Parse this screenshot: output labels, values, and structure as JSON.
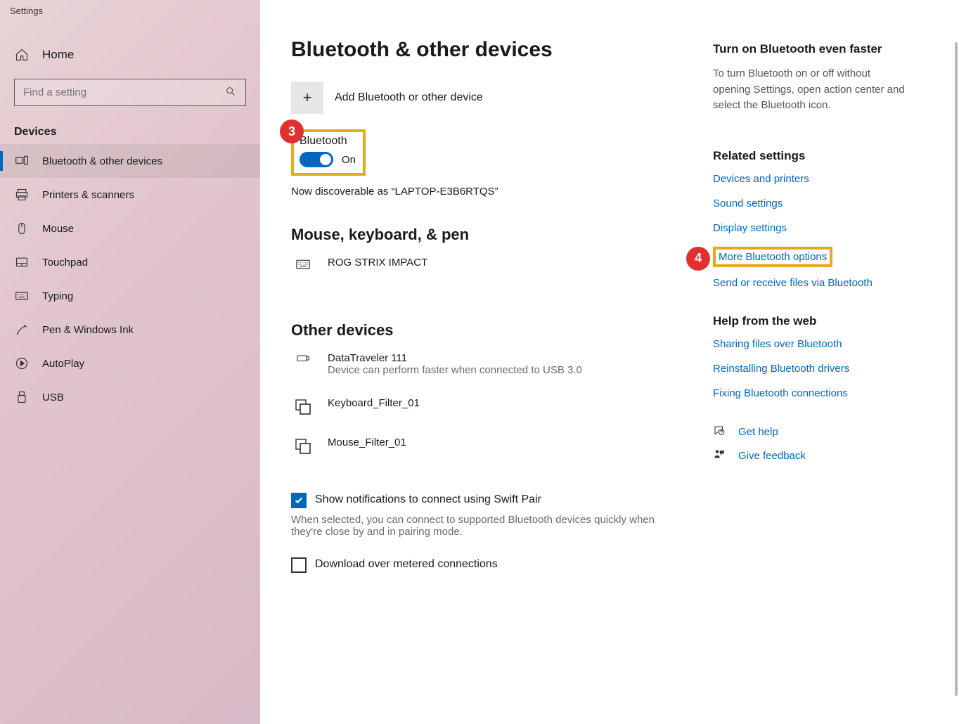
{
  "window": {
    "title": "Settings"
  },
  "sidebar": {
    "home_label": "Home",
    "search_placeholder": "Find a setting",
    "category": "Devices",
    "items": [
      {
        "label": "Bluetooth & other devices"
      },
      {
        "label": "Printers & scanners"
      },
      {
        "label": "Mouse"
      },
      {
        "label": "Touchpad"
      },
      {
        "label": "Typing"
      },
      {
        "label": "Pen & Windows Ink"
      },
      {
        "label": "AutoPlay"
      },
      {
        "label": "USB"
      }
    ]
  },
  "main": {
    "title": "Bluetooth & other devices",
    "add_label": "Add Bluetooth or other device",
    "bt_label": "Bluetooth",
    "bt_state": "On",
    "discoverable": "Now discoverable as “LAPTOP-E3B6RTQS”",
    "section1": "Mouse, keyboard, & pen",
    "mkp": [
      {
        "name": "ROG STRIX IMPACT"
      }
    ],
    "section2": "Other devices",
    "other": [
      {
        "name": "DataTraveler 111",
        "sub": "Device can perform faster when connected to USB 3.0"
      },
      {
        "name": "Keyboard_Filter_01"
      },
      {
        "name": "Mouse_Filter_01"
      }
    ],
    "swift_label": "Show notifications to connect using Swift Pair",
    "swift_desc": "When selected, you can connect to supported Bluetooth devices quickly when they're close by and in pairing mode.",
    "metered_label": "Download over metered connections"
  },
  "right": {
    "tip_h": "Turn on Bluetooth even faster",
    "tip_p": "To turn Bluetooth on or off without opening Settings, open action center and select the Bluetooth icon.",
    "related_h": "Related settings",
    "links": [
      "Devices and printers",
      "Sound settings",
      "Display settings",
      "More Bluetooth options",
      "Send or receive files via Bluetooth"
    ],
    "help_h": "Help from the web",
    "help_links": [
      "Sharing files over Bluetooth",
      "Reinstalling Bluetooth drivers",
      "Fixing Bluetooth connections"
    ],
    "get_help": "Get help",
    "give_feedback": "Give feedback"
  },
  "annotations": {
    "badge3": "3",
    "badge4": "4"
  }
}
